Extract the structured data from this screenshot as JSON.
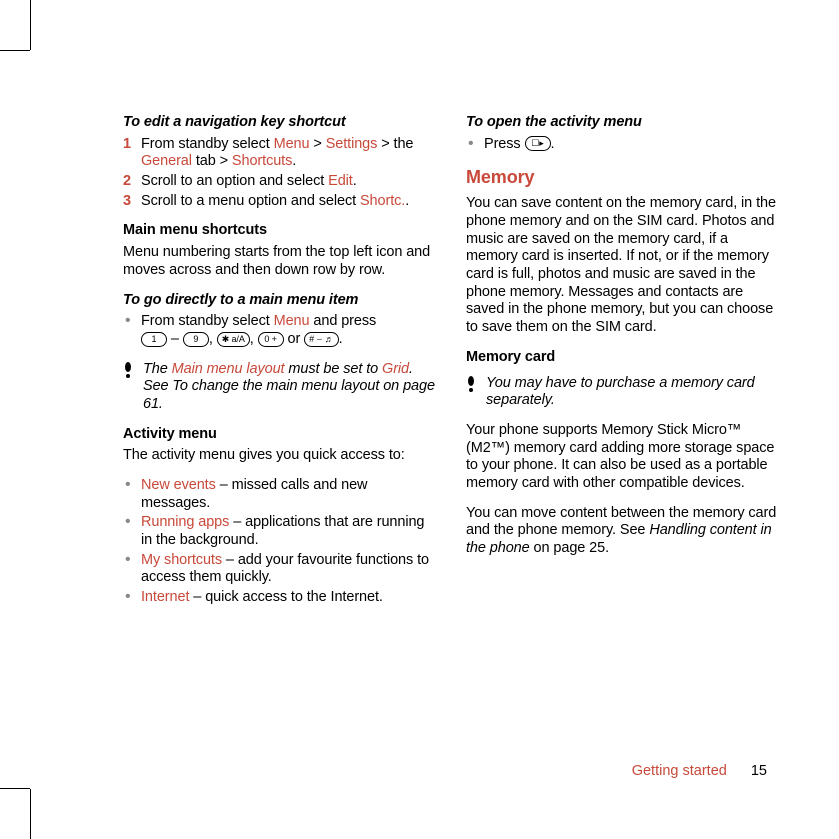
{
  "left": {
    "h1": "To edit a navigation key shortcut",
    "steps": [
      {
        "num": "1",
        "pre": "From standby select ",
        "l1": "Menu",
        "mid1": " > ",
        "l2": "Settings",
        "mid2": " > the ",
        "l3": "General",
        "mid3": " tab > ",
        "l4": "Shortcuts",
        "post": "."
      },
      {
        "num": "2",
        "pre": "Scroll to an option and select ",
        "l1": "Edit",
        "post": "."
      },
      {
        "num": "3",
        "pre": "Scroll to a menu option and select ",
        "l1": "Shortc.",
        "post": "."
      }
    ],
    "h2": "Main menu shortcuts",
    "p2": "Menu numbering starts from the top left icon and moves across and then down row by row.",
    "h3": "To go directly to a main menu item",
    "b3_pre": "From standby select ",
    "b3_menu": "Menu",
    "b3_mid": " and press ",
    "keys": {
      "k1": "1",
      "dash": " – ",
      "k9": "9",
      "c1": ", ",
      "kstar": "✱ a/A",
      "c2": ", ",
      "k0": "0 +",
      "or": " or ",
      "khash": "# ⌣ ♬",
      "end": "."
    },
    "note1_a": "The ",
    "note1_b": "Main menu layout",
    "note1_c": " must be set to ",
    "note1_d": "Grid",
    "note1_e": ". See To change the main menu layout on page 61.",
    "h4": "Activity menu",
    "p4": "The activity menu gives you quick access to:",
    "list": [
      {
        "t": "New events",
        "d": " – missed calls and new messages."
      },
      {
        "t": "Running apps",
        "d": " – applications that are running in the background."
      },
      {
        "t": "My shortcuts",
        "d": " – add your favourite functions to access them quickly."
      },
      {
        "t": "Internet",
        "d": " – quick access to the Internet."
      }
    ]
  },
  "right": {
    "h1": "To open the activity menu",
    "b1_pre": "Press ",
    "b1_key": "☐▸",
    "b1_post": ".",
    "h2": "Memory",
    "p2": "You can save content on the memory card, in the phone memory and on the SIM card. Photos and music are saved on the memory card, if a memory card is inserted. If not, or if the memory card is full, photos and music are saved in the phone memory. Messages and contacts are saved in the phone memory, but you can choose to save them on the SIM card.",
    "h3": "Memory card",
    "note2": "You may have to purchase a memory card separately.",
    "p3": "Your phone supports Memory Stick Micro™ (M2™) memory card adding more storage space to your phone. It can also be used as a portable memory card with other compatible devices.",
    "p4a": "You can move content between the memory card and the phone memory. See ",
    "p4b": "Handling content in the phone",
    "p4c": " on page 25."
  },
  "footer": {
    "section": "Getting started",
    "page": "15"
  }
}
